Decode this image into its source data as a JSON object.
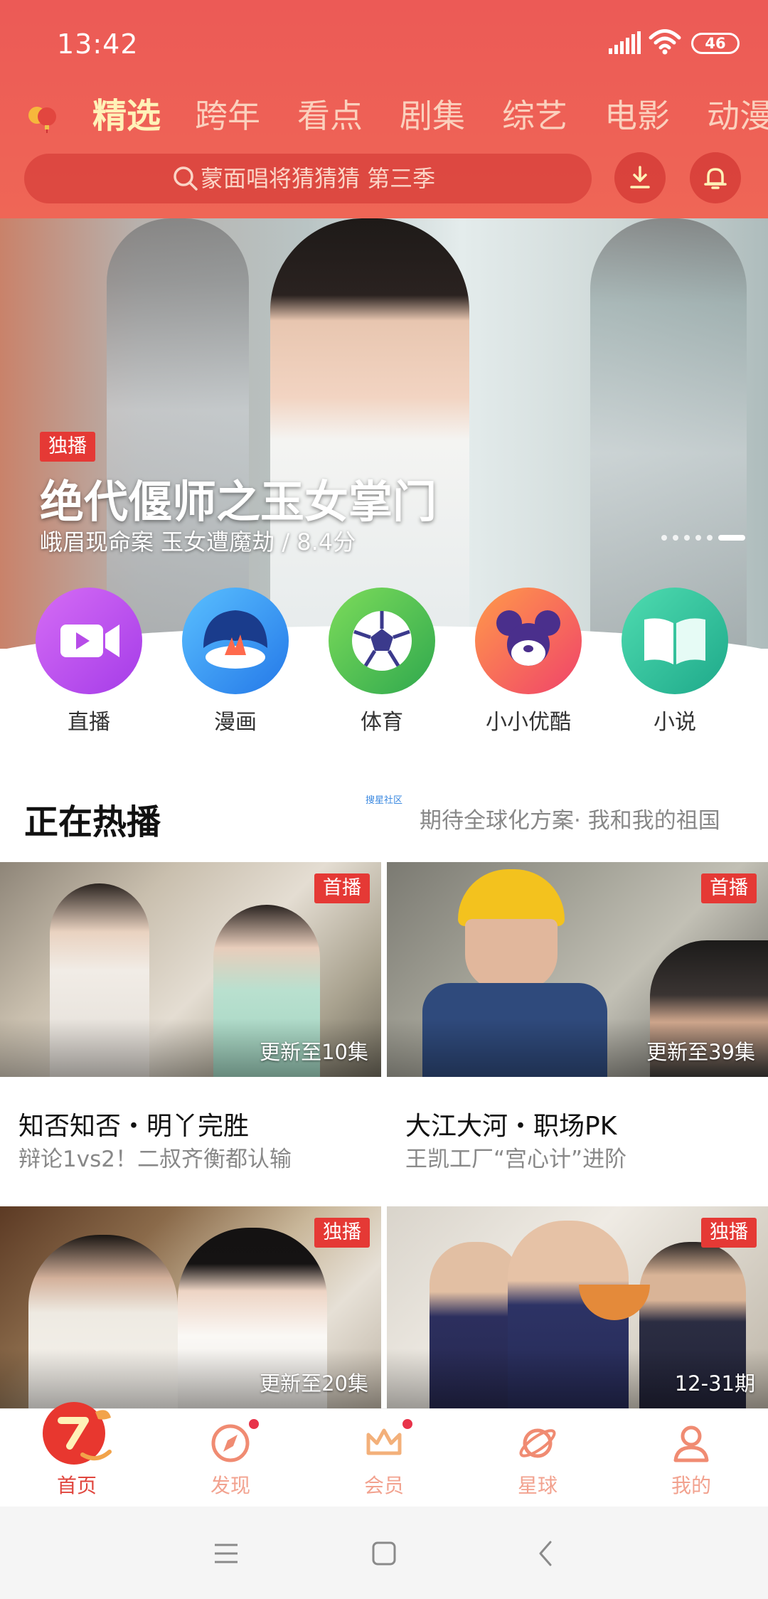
{
  "status_bar": {
    "time": "13:42",
    "battery": "46"
  },
  "header": {
    "tabs": [
      "精选",
      "跨年",
      "看点",
      "剧集",
      "综艺",
      "电影",
      "动漫"
    ],
    "active_tab": "精选",
    "search_placeholder": "蒙面唱将猜猜猜 第三季"
  },
  "banner": {
    "badge": "独播",
    "title": "绝代偃师之玉女掌门",
    "subtitle": "峨眉现命案 玉女遭魔劫 / 8.4分"
  },
  "categories": [
    {
      "label": "直播"
    },
    {
      "label": "漫画"
    },
    {
      "label": "体育"
    },
    {
      "label": "小小优酷"
    },
    {
      "label": "小说"
    }
  ],
  "hot_section": {
    "title": "正在热播",
    "tiny_label": "搜星社区",
    "right_text": "期待全球化方案· 我和我的祖国"
  },
  "cards": [
    {
      "tag": "首播",
      "episode": "更新至10集",
      "title": "知否知否・明丫完胜",
      "desc": "辩论1vs2！二叔齐衡都认输"
    },
    {
      "tag": "首播",
      "episode": "更新至39集",
      "title": "大江大河・职场PK",
      "desc": "王凯工厂“宫心计”进阶"
    },
    {
      "tag": "独播",
      "episode": "更新至20集",
      "title": "",
      "desc": ""
    },
    {
      "tag": "独播",
      "episode": "12-31期",
      "title": "",
      "desc": ""
    }
  ],
  "bottom_nav": [
    {
      "label": "首页"
    },
    {
      "label": "发现"
    },
    {
      "label": "会员"
    },
    {
      "label": "星球"
    },
    {
      "label": "我的"
    }
  ],
  "colors": {
    "brand_red": "#ec5a56",
    "tag_red": "#e53935",
    "active_tab": "#fff2b8",
    "nav_label": "#f2a28f"
  }
}
